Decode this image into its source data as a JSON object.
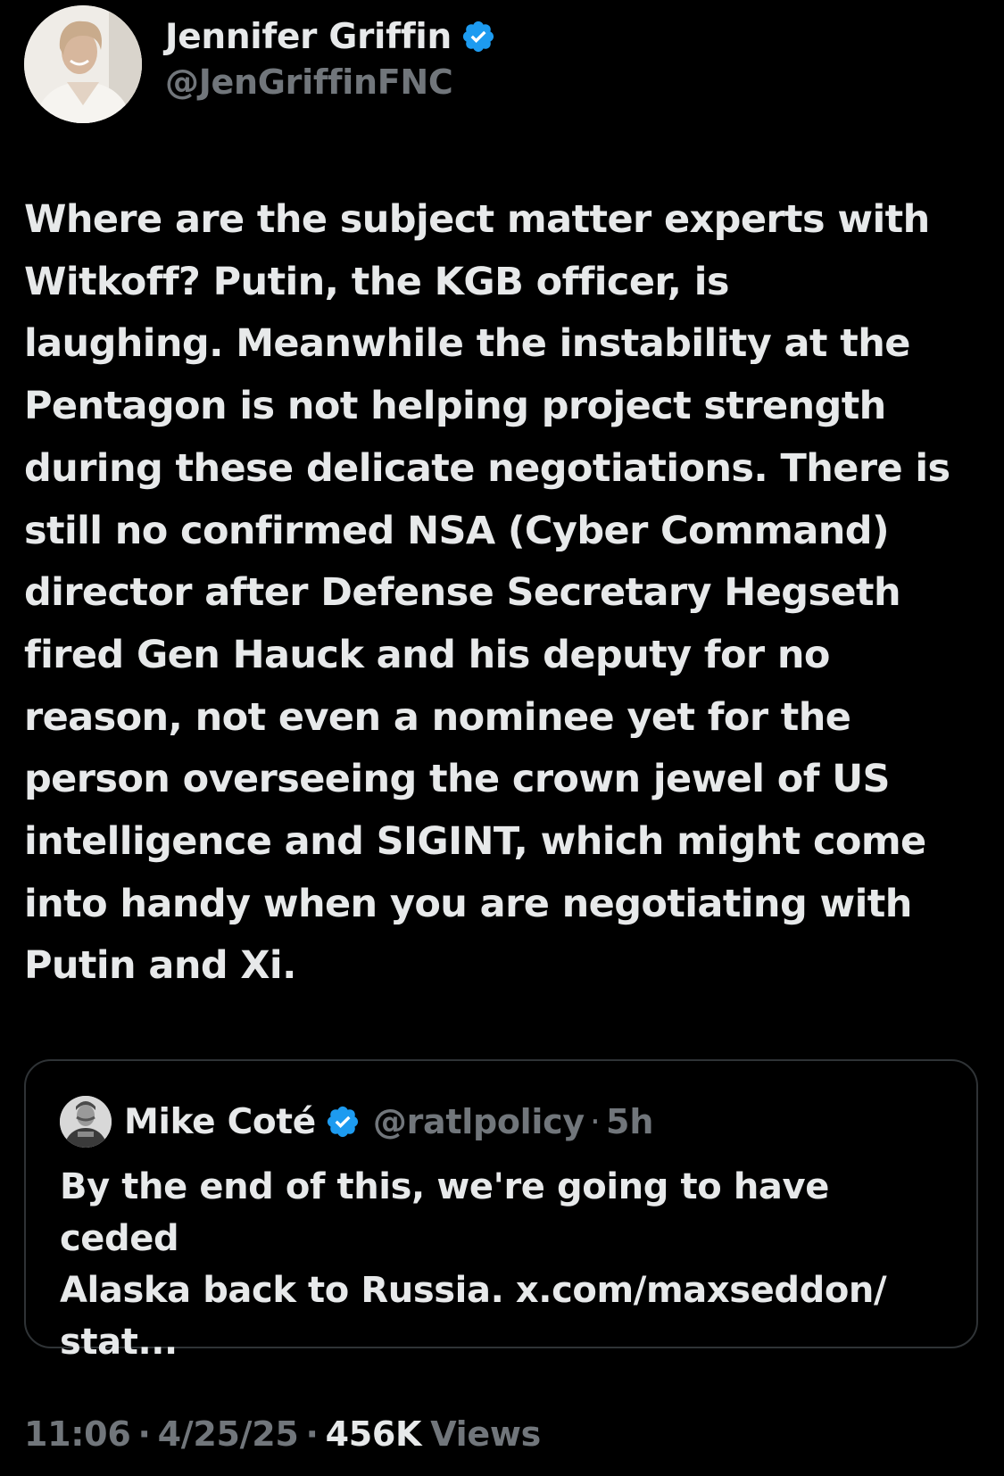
{
  "colors": {
    "background": "#000000",
    "text_primary": "#e7e9ea",
    "text_secondary": "#71767b",
    "verified_blue": "#1d9bf0",
    "border": "#2f3336"
  },
  "author": {
    "display_name": "Jennifer Griffin",
    "handle": "@JenGriffinFNC",
    "verified": true,
    "avatar_icon": "profile-photo"
  },
  "tweet": {
    "text": "Where are the subject matter experts with\nWitkoff? Putin, the KGB officer, is\nlaughing. Meanwhile the instability at the\nPentagon is not helping project strength\nduring these delicate negotiations. There is\nstill no confirmed NSA (Cyber Command)\ndirector after Defense Secretary Hegseth\nfired Gen Hauck and his deputy for no\nreason, not even a nominee yet for the\nperson overseeing the crown jewel of US\nintelligence and SIGINT, which might come\ninto handy when you are negotiating with\nPutin and Xi."
  },
  "quoted_tweet": {
    "display_name": "Mike Coté",
    "verified": true,
    "handle": "@ratlpolicy",
    "separator": "·",
    "time": "5h",
    "text": "By the end of this, we're going to have ceded\nAlaska back to Russia. x.com/maxseddon/\nstat..."
  },
  "footer": {
    "time": "11:06",
    "separator": "·",
    "date": "4/25/25",
    "views_count": "456K",
    "views_label": "Views"
  }
}
